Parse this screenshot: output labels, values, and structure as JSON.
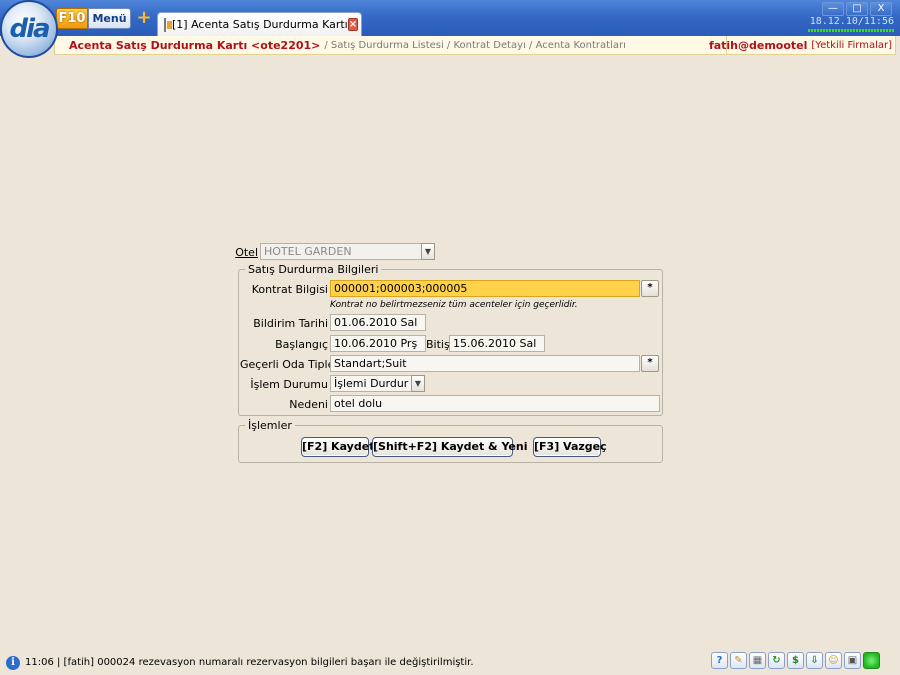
{
  "app": {
    "logo_text": "dia",
    "f10_label": "F10",
    "menu_label": "Menü",
    "add_tab_symbol": "+",
    "tab_label": "[1] Acenta Satış Durdurma Kartı",
    "tab_close": "×",
    "clock": "18.12.10/11:56",
    "window_buttons": {
      "minimize": "—",
      "maximize": "□",
      "close": "X"
    }
  },
  "breadcrumb": {
    "current": "Acenta Satış Durdurma Kartı <ote2201>",
    "rest": "/ Satış Durdurma Listesi / Kontrat Detayı / Acenta Kontratları"
  },
  "user": {
    "name": "fatih@demootel",
    "firms_link": "[Yetkili Firmalar]"
  },
  "form": {
    "otel": {
      "label": "Otel",
      "value": "HOTEL GARDEN"
    },
    "group_label": "Satış Durdurma Bilgileri",
    "kontrat": {
      "label": "Kontrat Bilgisi",
      "value": "000001;000003;000005",
      "hint": "Kontrat no belirtmezseniz tüm acenteler için geçerlidir."
    },
    "bildirim": {
      "label": "Bildirim Tarihi",
      "value": "01.06.2010 Sal"
    },
    "baslangic": {
      "label": "Başlangıç",
      "value": "10.06.2010 Prş"
    },
    "bitis": {
      "label": "Bitiş",
      "value": "15.06.2010 Sal"
    },
    "oda_tipleri": {
      "label": "Geçerli Oda Tipleri",
      "value": "Standart;Suit"
    },
    "islem_durumu": {
      "label": "İşlem Durumu",
      "value": "İşlemi Durdur"
    },
    "nedeni": {
      "label": "Nedeni",
      "value": "otel dolu"
    },
    "dots_button": "*"
  },
  "actions": {
    "group_label": "İşlemler",
    "save": "[F2] Kaydet",
    "save_new": "[Shift+F2] Kaydet & Yeni",
    "cancel": "[F3] Vazgeç"
  },
  "status": {
    "text": "11:06 | [fatih] 000024 rezevasyon numaralı rezervasyon bilgileri başarı ile değiştirilmiştir."
  },
  "colors": {
    "accent_red": "#b0101a",
    "highlight_field": "#ffd24a",
    "background": "#ece5d8"
  }
}
